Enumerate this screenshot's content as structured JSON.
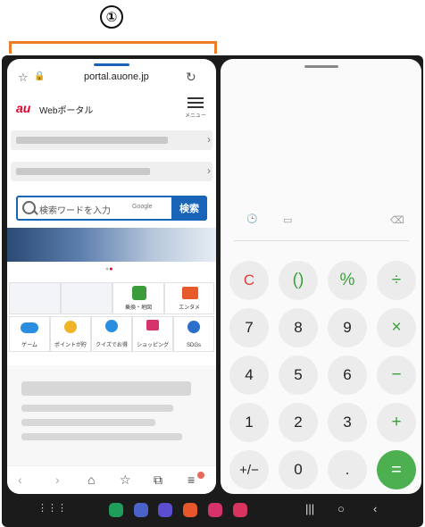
{
  "callout": {
    "marker": "①"
  },
  "browser": {
    "url": "portal.auone.jp",
    "logo": "au",
    "portal_name": "Webポータル",
    "menu_label": "メニュー",
    "search_placeholder": "検索ワードを入力",
    "search_powered": "Google",
    "search_button": "検索",
    "services_row1": [
      "",
      "",
      "乗換・地図",
      "エンタメ"
    ],
    "services_row2": [
      "ゲーム",
      "ポイントが貯",
      "クイズでお得",
      "ショッピング",
      "SDGs"
    ],
    "toolbar_icons": [
      "back-icon",
      "forward-icon",
      "home-icon",
      "bookmark-add-icon",
      "tabs-icon",
      "menu-icon"
    ]
  },
  "calculator": {
    "tools": [
      "history-icon",
      "ruler-icon",
      "backspace-icon"
    ],
    "keys": [
      [
        "C",
        "()",
        "%",
        "÷"
      ],
      [
        "7",
        "8",
        "9",
        "×"
      ],
      [
        "4",
        "5",
        "6",
        "−"
      ],
      [
        "1",
        "2",
        "3",
        "+"
      ],
      [
        "+/−",
        "0",
        ".",
        "="
      ]
    ]
  },
  "system_bar": {
    "apps": [
      "phone",
      "messages",
      "internet",
      "galaxy-store",
      "gallery",
      "camera"
    ],
    "colors": {
      "accent_orange": "#ee7d2a",
      "au_red": "#e4002b",
      "search_blue": "#1a64b8",
      "calc_green": "#4caf50"
    }
  }
}
